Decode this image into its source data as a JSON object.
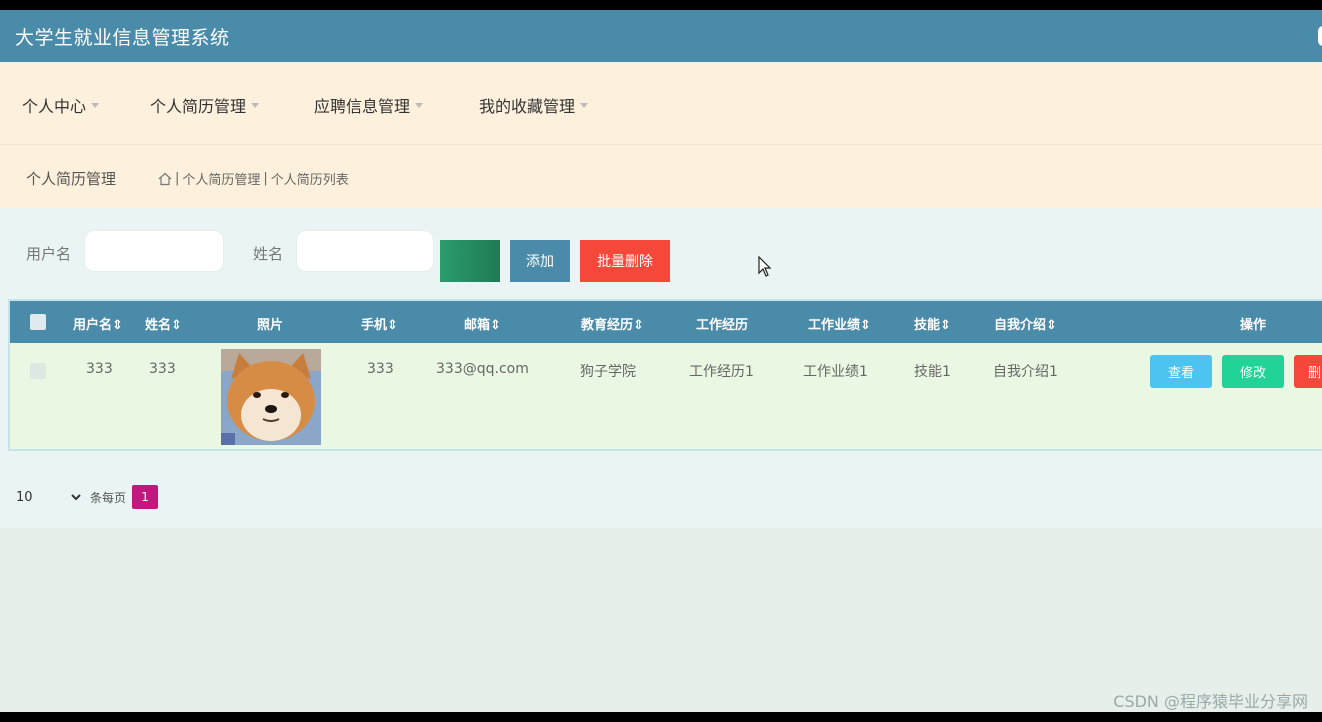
{
  "app": {
    "title": "大学生就业信息管理系统"
  },
  "menu": [
    {
      "label": "个人中心"
    },
    {
      "label": "个人简历管理"
    },
    {
      "label": "应聘信息管理"
    },
    {
      "label": "我的收藏管理"
    }
  ],
  "breadcrumb": {
    "title": "个人简历管理",
    "level1": "个人简历管理",
    "level2": "个人简历列表"
  },
  "search": {
    "username_label": "用户名",
    "name_label": "姓名",
    "add_label": "添加",
    "batch_delete_label": "批量删除"
  },
  "table": {
    "headers": {
      "username": "用户名",
      "name": "姓名",
      "photo": "照片",
      "phone": "手机",
      "email": "邮箱",
      "education": "教育经历",
      "work_history": "工作经历",
      "work_performance": "工作业绩",
      "skills": "技能",
      "self_intro": "自我介绍",
      "actions": "操作"
    },
    "rows": [
      {
        "username": "333",
        "name": "333",
        "phone": "333",
        "email": "333@qq.com",
        "education": "狗子学院",
        "work_history": "工作经历1",
        "work_performance": "工作业绩1",
        "skills": "技能1",
        "self_intro": "自我介绍1",
        "view_label": "查看",
        "edit_label": "修改",
        "delete_label": "删"
      }
    ]
  },
  "pagination": {
    "page_size": "10",
    "page_size_options": [
      "10"
    ],
    "per_page_label": "条每页",
    "current_page": "1"
  },
  "watermark": "CSDN @程序猿毕业分享网",
  "colors": {
    "header": "#4b8baa",
    "menu_bg": "#fdf0dc",
    "danger": "#f5483a",
    "success": "#21d397",
    "info": "#4dc4ef",
    "page_active": "#c2187d"
  },
  "icons": [
    "home-icon",
    "caret-down-icon",
    "sort-icon",
    "mouse-cursor-icon"
  ]
}
